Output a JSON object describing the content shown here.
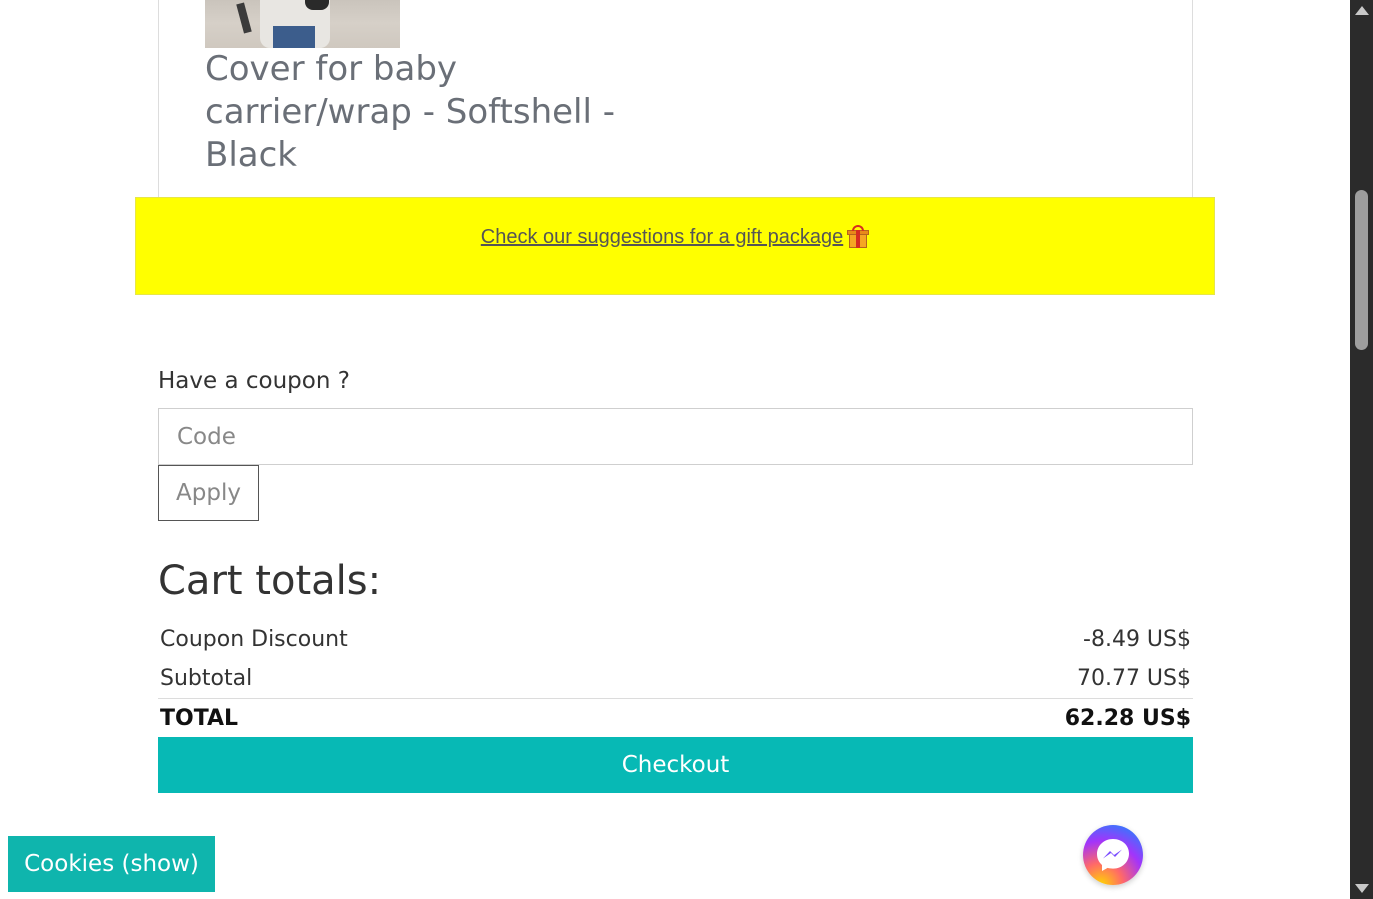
{
  "product": {
    "title": "Cover for baby carrier/wrap - Softshell - Black"
  },
  "gift_banner": {
    "link_text": "Check our suggestions for a gift package ",
    "icon": "gift-icon",
    "background": "#ffff00"
  },
  "coupon": {
    "label": "Have a coupon ?",
    "placeholder": "Code",
    "value": "",
    "apply_label": "Apply"
  },
  "totals": {
    "heading": "Cart totals:",
    "rows": [
      {
        "label": "Coupon Discount",
        "value": "-8.49 US$"
      },
      {
        "label": "Subtotal",
        "value": "70.77 US$"
      }
    ],
    "total": {
      "label": "TOTAL",
      "value": "62.28 US$"
    },
    "checkout_label": "Checkout",
    "accent": "#07b9b5"
  },
  "cookies": {
    "label": "Cookies (show)"
  },
  "messenger": {
    "icon": "messenger-icon"
  }
}
